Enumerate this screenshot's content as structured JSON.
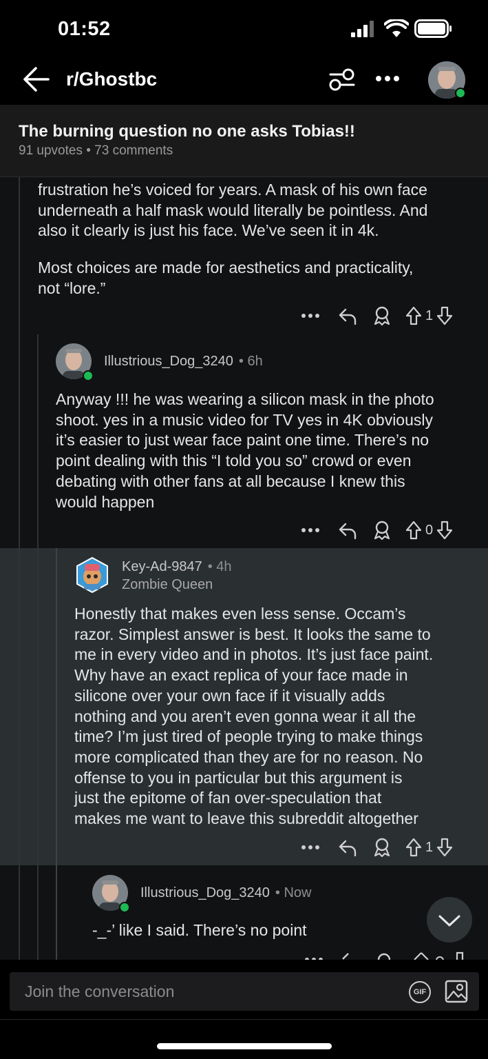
{
  "status_bar": {
    "time": "01:52"
  },
  "header": {
    "subreddit": "r/Ghostbc"
  },
  "post": {
    "title": "The burning question no one asks Tobias!!",
    "meta": "91 upvotes • 73 comments"
  },
  "comments": [
    {
      "text_lines": [
        "frustration he’s voiced for years. A mask of his own face",
        "underneath a half mask would literally be pointless. And",
        "also it clearly is just his face. We’ve seen it in 4k."
      ],
      "text_lines_2": [
        "Most choices are made for aesthetics and practicality,",
        "not “lore.”"
      ],
      "votes": "1"
    },
    {
      "username": "Illustrious_Dog_3240",
      "time": "• 6h",
      "text_lines": [
        "Anyway !!! he was wearing a silicon mask in the photo",
        "shoot. yes in a music video for TV yes in 4K obviously",
        "it’s easier to just wear face paint one time. There’s no",
        "point dealing with this “I told you so” crowd or even",
        "debating with other fans at all because I knew this",
        "would happen"
      ],
      "votes": "0"
    },
    {
      "username": "Key-Ad-9847",
      "time": "• 4h",
      "flair": "Zombie Queen",
      "text_lines": [
        "Honestly that makes even less sense. Occam’s",
        "razor. Simplest answer is best. It looks the same to",
        "me in every video and in photos. It’s just face paint.",
        "Why have an exact replica of your face made in",
        "silicone over your own face if it visually adds",
        "nothing and you aren’t even gonna wear it all the",
        "time? I’m just tired of people trying to make things",
        "more complicated than they are for no reason. No",
        "offense to you in particular but this argument is",
        "just the epitome of fan over-speculation that",
        "makes me want to leave this subreddit altogether"
      ],
      "votes": "1"
    },
    {
      "username": "Illustrious_Dog_3240",
      "time": "• Now",
      "text_lines": [
        "-_-’ like I said. There’s no point"
      ]
    }
  ],
  "composer": {
    "placeholder": "Join the conversation",
    "gif_label": "GIF"
  },
  "icons": [
    "back-arrow-icon",
    "filter-icon",
    "more-icon",
    "avatar",
    "reply-icon",
    "award-icon",
    "upvote-icon",
    "downvote-icon",
    "chevron-down-icon",
    "image-icon"
  ]
}
